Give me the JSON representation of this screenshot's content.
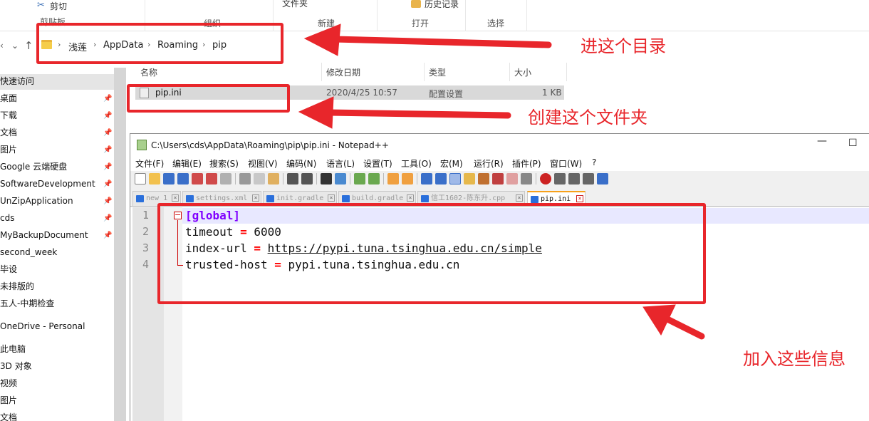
{
  "ribbon": {
    "cut_label": "剪切",
    "new_folder_label": "文件夹",
    "history_label": "历史记录",
    "groups": [
      "剪贴板",
      "组织",
      "新建",
      "打开",
      "选择"
    ]
  },
  "address": {
    "breadcrumbs": [
      "浅莲",
      "AppData",
      "Roaming",
      "pip"
    ]
  },
  "navpane": {
    "quick_access": "快速访问",
    "items": [
      "桌面",
      "下载",
      "文档",
      "图片",
      "Google 云端硬盘",
      "SoftwareDevelopment",
      "UnZipApplication",
      "cds",
      "MyBackupDocument",
      "second_week",
      "毕设",
      "未排版的",
      "五人-中期检查"
    ],
    "onedrive": "OneDrive - Personal",
    "this_pc": "此电脑",
    "pc_items": [
      "3D 对象",
      "视频",
      "图片",
      "文档"
    ]
  },
  "filelist": {
    "columns": [
      "名称",
      "修改日期",
      "类型",
      "大小"
    ],
    "rows": [
      {
        "name": "pip.ini",
        "modified": "2020/4/25 10:57",
        "type": "配置设置",
        "size": "1 KB"
      }
    ]
  },
  "notepad": {
    "title": "C:\\Users\\cds\\AppData\\Roaming\\pip\\pip.ini - Notepad++",
    "menu": [
      "文件(F)",
      "编辑(E)",
      "搜索(S)",
      "视图(V)",
      "编码(N)",
      "语言(L)",
      "设置(T)",
      "工具(O)",
      "宏(M)",
      "运行(R)",
      "插件(P)",
      "窗口(W)",
      "?"
    ],
    "tabs": [
      "new 1",
      "settings.xml",
      "init.gradle",
      "build.gradle",
      "信工1602-陈东升.cpp",
      "pip.ini"
    ],
    "active_tab": "pip.ini",
    "lines": [
      {
        "num": "1",
        "text": "[global]"
      },
      {
        "num": "2",
        "key": "timeout",
        "eq": "=",
        "value": "6000"
      },
      {
        "num": "3",
        "key": "index-url",
        "eq": "=",
        "value": "https://pypi.tuna.tsinghua.edu.cn/simple"
      },
      {
        "num": "4",
        "key": "trusted-host",
        "eq": "=",
        "value": "pypi.tuna.tsinghua.edu.cn"
      }
    ]
  },
  "annotations": {
    "enter_dir": "进这个目录",
    "create_folder": "创建这个文件夹",
    "add_info": "加入这些信息",
    "color": "#e8262b"
  }
}
